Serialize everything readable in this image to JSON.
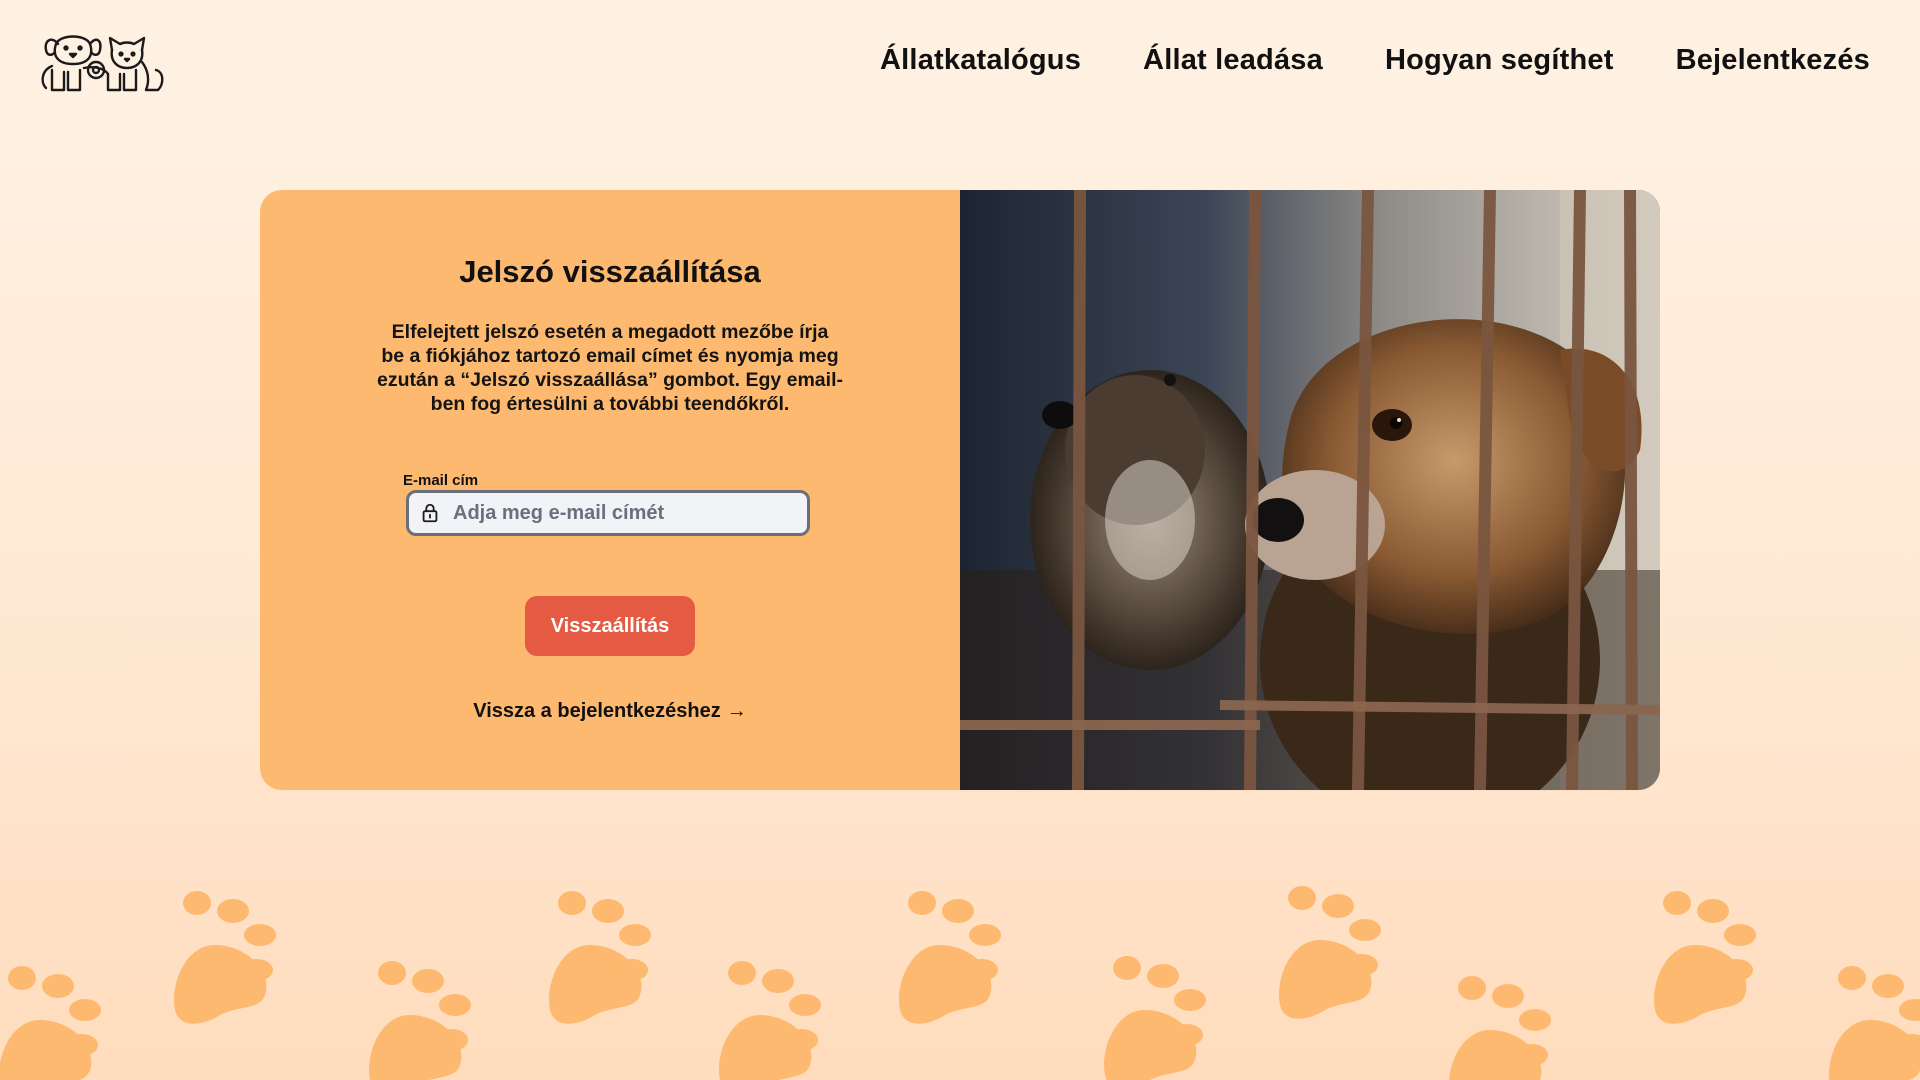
{
  "header": {
    "nav": [
      {
        "label": "Állatkatalógus"
      },
      {
        "label": "Állat leadása"
      },
      {
        "label": "Hogyan segíthet"
      },
      {
        "label": "Bejelentkezés"
      }
    ]
  },
  "form": {
    "title": "Jelszó visszaállítása",
    "description": "Elfelejtett jelszó esetén a megadott mezőbe írja\nbe a  fiókjához tartozó email címet és nyomja meg\nezután a “Jelszó visszaállása” gombot. Egy email-\nben fog értesülni a további teendőkről.",
    "email_label": "E-mail cím",
    "email_placeholder": "Adja meg e-mail címét",
    "email_value": "",
    "submit_label": "Visszaállítás",
    "back_label": "Vissza a bejelentkezéshez",
    "back_arrow": "→"
  },
  "icons": {
    "logo": "dog-and-cat-logo",
    "field": "lock-icon",
    "decoration": "paw-print-icon"
  },
  "colors": {
    "panel": "#fdb96f",
    "button": "#e45a43",
    "paws": "#fdb96f",
    "background": "#fff2e3"
  }
}
